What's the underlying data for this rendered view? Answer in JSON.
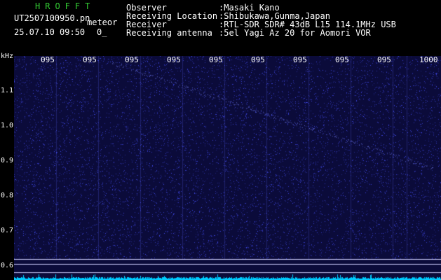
{
  "header": {
    "brand": "HROFFT",
    "filename": "UT2507100950.pn",
    "mode": "meteor",
    "datetime": "25.07.10 09:50",
    "counter": "0_",
    "observer_label": "Observer",
    "observer_value": ":Masaki Kano",
    "location_label": "Receiving Location",
    "location_value": ":Shibukawa,Gunma,Japan",
    "receiver_label": "Receiver",
    "receiver_value": ":RTL-SDR SDR# 43dB L15 114.1MHz USB",
    "antenna_label": "Receiving antenna",
    "antenna_value": ":5el Yagi Az 20 for Aomori VOR"
  },
  "waterfall": {
    "unit_label": "kHz",
    "y_ticks": [
      "1.1",
      "1.0",
      "0.9",
      "0.8",
      "0.7",
      "0.6"
    ],
    "x_ticks": [
      "095",
      "095",
      "095",
      "095",
      "095",
      "095",
      "095",
      "095",
      "095",
      "1000"
    ],
    "colors": {
      "background": "#0b0b3a",
      "noise": "#3a3aff",
      "trace": "#00ccff",
      "line": "#ffffff"
    }
  }
}
